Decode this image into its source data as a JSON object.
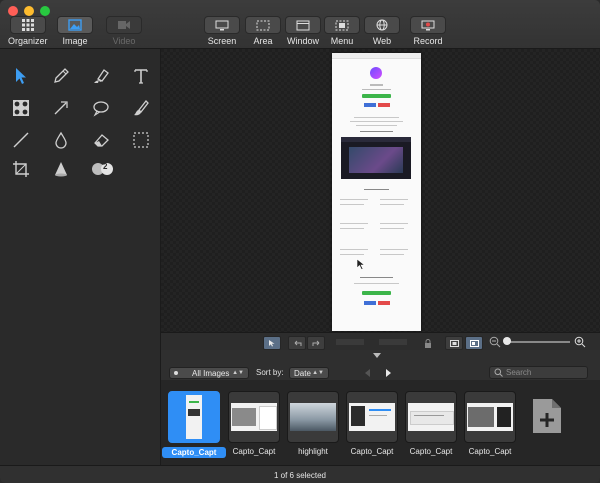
{
  "toolbar": {
    "left": [
      {
        "label": "Organizer",
        "icon": "grid-icon"
      },
      {
        "label": "Image",
        "icon": "image-icon"
      },
      {
        "label": "Video",
        "icon": "video-camera-icon"
      }
    ],
    "capture": [
      {
        "label": "Screen",
        "icon": "screen-icon"
      },
      {
        "label": "Area",
        "icon": "area-icon"
      },
      {
        "label": "Window",
        "icon": "window-icon"
      },
      {
        "label": "Menu",
        "icon": "menu-icon"
      },
      {
        "label": "Web",
        "icon": "globe-icon"
      },
      {
        "label": "Record",
        "icon": "record-icon"
      }
    ]
  },
  "tools": [
    "arrow-select-icon",
    "pen-icon",
    "highlighter-icon",
    "text-icon",
    "blur-icon",
    "arrow-icon",
    "speech-bubble-icon",
    "brush-icon",
    "line-icon",
    "drop-icon",
    "eraser-icon",
    "selection-rect-icon",
    "crop-icon",
    "cone-icon",
    "step-counter-icon"
  ],
  "step_counter": "2",
  "organizer": {
    "filter_value": "All Images",
    "sort_label": "Sort by:",
    "sort_value": "Date",
    "search_placeholder": "Search"
  },
  "thumbnails": [
    {
      "caption": "Capto_Capt",
      "selected": true
    },
    {
      "caption": "Capto_Capt",
      "selected": false
    },
    {
      "caption": "highlight",
      "selected": false
    },
    {
      "caption": "Capto_Capt",
      "selected": false
    },
    {
      "caption": "Capto_Capt",
      "selected": false
    },
    {
      "caption": "Capto_Capt",
      "selected": false
    }
  ],
  "status": "1 of 6 selected",
  "colors": {
    "accent": "#2f8ef5",
    "tool_active": "#3d9df2",
    "background": "#262626"
  }
}
